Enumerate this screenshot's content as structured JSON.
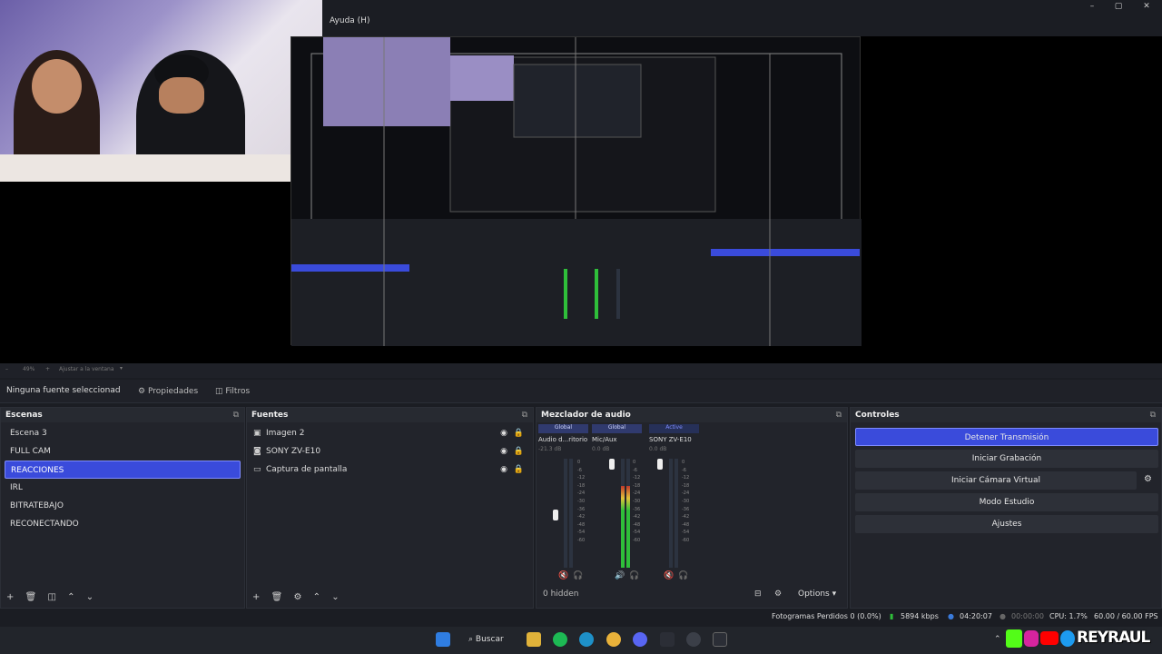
{
  "window": {
    "menu_help": "Ayuda (H)",
    "minimize": "–",
    "maximize": "▢",
    "close": "✕"
  },
  "preview_toolbar": {
    "zoom": "49%",
    "fit": "Ajustar a la ventana"
  },
  "props_bar": {
    "no_source": "Ninguna fuente seleccionad",
    "properties": "Propiedades",
    "filters": "Filtros"
  },
  "scenes": {
    "title": "Escenas",
    "items": [
      {
        "label": "Escena 3"
      },
      {
        "label": "FULL CAM"
      },
      {
        "label": "REACCIONES"
      },
      {
        "label": "IRL"
      },
      {
        "label": "BITRATEBAJO"
      },
      {
        "label": "RECONECTANDO"
      }
    ],
    "selected_index": 2
  },
  "sources": {
    "title": "Fuentes",
    "items": [
      {
        "label": "Imagen 2",
        "icon": "image-icon"
      },
      {
        "label": "SONY ZV-E10",
        "icon": "camera-icon"
      },
      {
        "label": "Captura de pantalla",
        "icon": "display-icon"
      }
    ]
  },
  "audio": {
    "title": "Mezclador de audio",
    "channels": [
      {
        "tag": "Global",
        "name": "Audio d...ritorio",
        "db": "-21.3 dB",
        "level": 0.0
      },
      {
        "tag": "Global",
        "name": "Mic/Aux",
        "db": "0.0 dB",
        "level": 0.75
      },
      {
        "tag": "Active",
        "name": "SONY ZV-E10",
        "db": "0.0 dB",
        "level": 0.0
      }
    ],
    "ticks": [
      "0",
      "-6",
      "-12",
      "-18",
      "-24",
      "-30",
      "-36",
      "-42",
      "-48",
      "-54",
      "-60"
    ],
    "hidden": "0 hidden",
    "options": "Options"
  },
  "controls": {
    "title": "Controles",
    "stop_stream": "Detener Transmisión",
    "start_record": "Iniciar Grabación",
    "virtual_cam": "Iniciar Cámara Virtual",
    "studio_mode": "Modo Estudio",
    "settings": "Ajustes"
  },
  "status": {
    "dropped": "Fotogramas Perdidos 0 (0.0%)",
    "bitrate": "5894 kbps",
    "stream_time": "04:20:07",
    "rec_time": "00:00:00",
    "cpu": "CPU: 1.7%",
    "fps": "60.00 / 60.00 FPS"
  },
  "taskbar": {
    "search": "Buscar"
  },
  "brand": {
    "text": "REYRAUL"
  },
  "colors": {
    "accent": "#3a4bdb",
    "meter_green": "#2fbf3a",
    "meter_red": "#c0392b"
  }
}
